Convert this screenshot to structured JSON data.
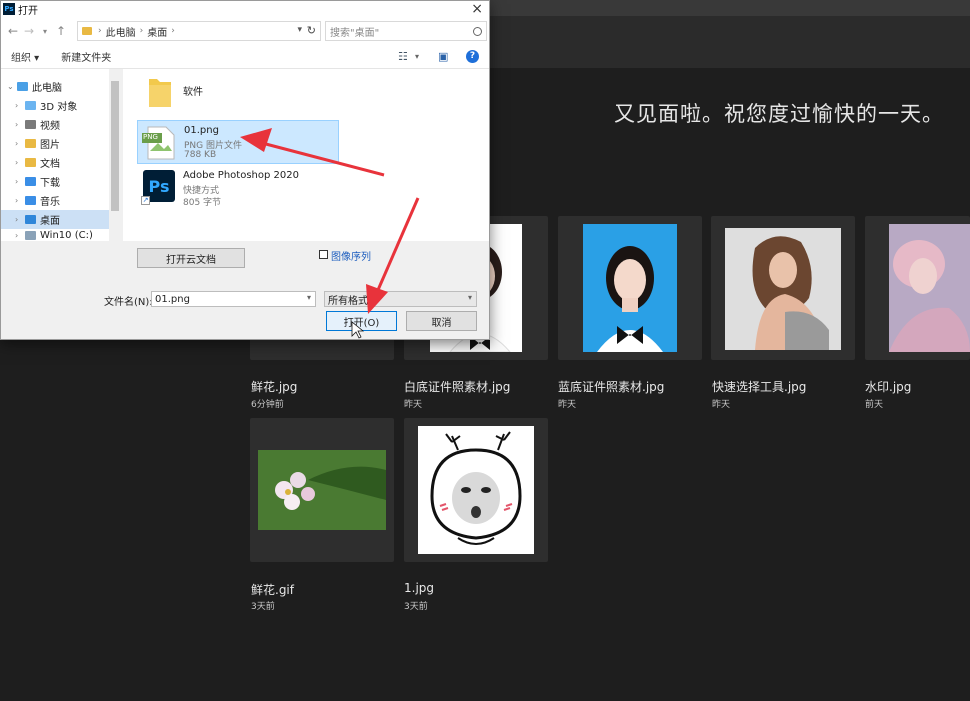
{
  "greeting": "又见面啦。祝您度过愉快的一天。",
  "recent_files": [
    {
      "name": "鲜花.jpg",
      "time": "6分钟前"
    },
    {
      "name": "白底证件照素材.jpg",
      "time": "昨天"
    },
    {
      "name": "蓝底证件照素材.jpg",
      "time": "昨天"
    },
    {
      "name": "快速选择工具.jpg",
      "time": "昨天"
    },
    {
      "name": "水印.jpg",
      "time": "前天"
    },
    {
      "name": "鲜花.gif",
      "time": "3天前"
    },
    {
      "name": "1.jpg",
      "time": "3天前"
    }
  ],
  "dialog": {
    "title": "打开",
    "app_badge": "Ps",
    "address": [
      "此电脑",
      "桌面"
    ],
    "search_placeholder": "搜索\"桌面\"",
    "organize": "组织 ▾",
    "new_folder": "新建文件夹",
    "nav": [
      {
        "label": "此电脑",
        "icon": "computer-icon"
      },
      {
        "label": "3D 对象",
        "icon": "3d-objects-icon"
      },
      {
        "label": "视频",
        "icon": "video-folder-icon"
      },
      {
        "label": "图片",
        "icon": "pictures-folder-icon"
      },
      {
        "label": "文档",
        "icon": "documents-folder-icon"
      },
      {
        "label": "下载",
        "icon": "downloads-folder-icon"
      },
      {
        "label": "音乐",
        "icon": "music-folder-icon"
      },
      {
        "label": "桌面",
        "icon": "desktop-folder-icon"
      },
      {
        "label": "Win10 (C:)",
        "icon": "drive-icon"
      }
    ],
    "files": [
      {
        "name": "软件",
        "line1": "",
        "line2": ""
      },
      {
        "name": "01.png",
        "line1": "PNG 图片文件",
        "line2": "788 KB"
      },
      {
        "name": "Adobe Photoshop 2020",
        "line1": "快捷方式",
        "line2": "805 字节"
      }
    ],
    "png_label": "PNG",
    "ps_label": "Ps",
    "cloud_button": "打开云文档",
    "image_sequence": "图像序列",
    "filename_label": "文件名(N):",
    "filename_value": "01.png",
    "format_value": "所有格式",
    "open_button": "打开(O)",
    "cancel_button": "取消"
  },
  "colors": {
    "accent": "#0078d7",
    "arrow": "#e8333b",
    "ps_blue": "#31a8ff",
    "ps_dark": "#001e36"
  }
}
